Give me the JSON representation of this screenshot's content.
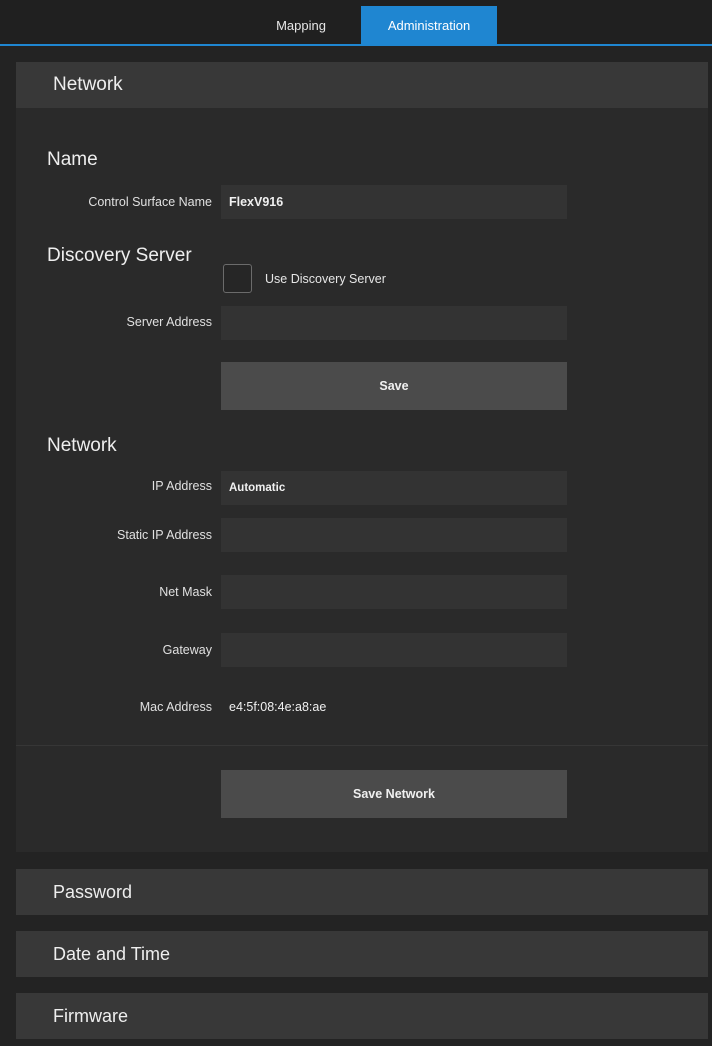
{
  "tabs": [
    {
      "label": "Mapping",
      "active": false
    },
    {
      "label": "Administration",
      "active": true
    }
  ],
  "accent_color": "#1f86d1",
  "network_panel": {
    "title": "Network",
    "name_section": {
      "title": "Name",
      "control_surface_name_label": "Control Surface Name",
      "control_surface_name_value": "FlexV916"
    },
    "discovery_section": {
      "title": "Discovery Server",
      "use_discovery_label": "Use Discovery Server",
      "use_discovery_checked": false,
      "server_address_label": "Server Address",
      "server_address_value": "",
      "save_label": "Save"
    },
    "network_section": {
      "title": "Network",
      "ip_address_label": "IP Address",
      "ip_address_value": "Automatic",
      "static_ip_label": "Static IP Address",
      "static_ip_value": "",
      "net_mask_label": "Net Mask",
      "net_mask_value": "",
      "gateway_label": "Gateway",
      "gateway_value": "",
      "mac_address_label": "Mac Address",
      "mac_address_value": "e4:5f:08:4e:a8:ae"
    },
    "save_network_label": "Save Network"
  },
  "collapsed_panels": [
    {
      "title": "Password"
    },
    {
      "title": "Date and Time"
    },
    {
      "title": "Firmware"
    }
  ]
}
